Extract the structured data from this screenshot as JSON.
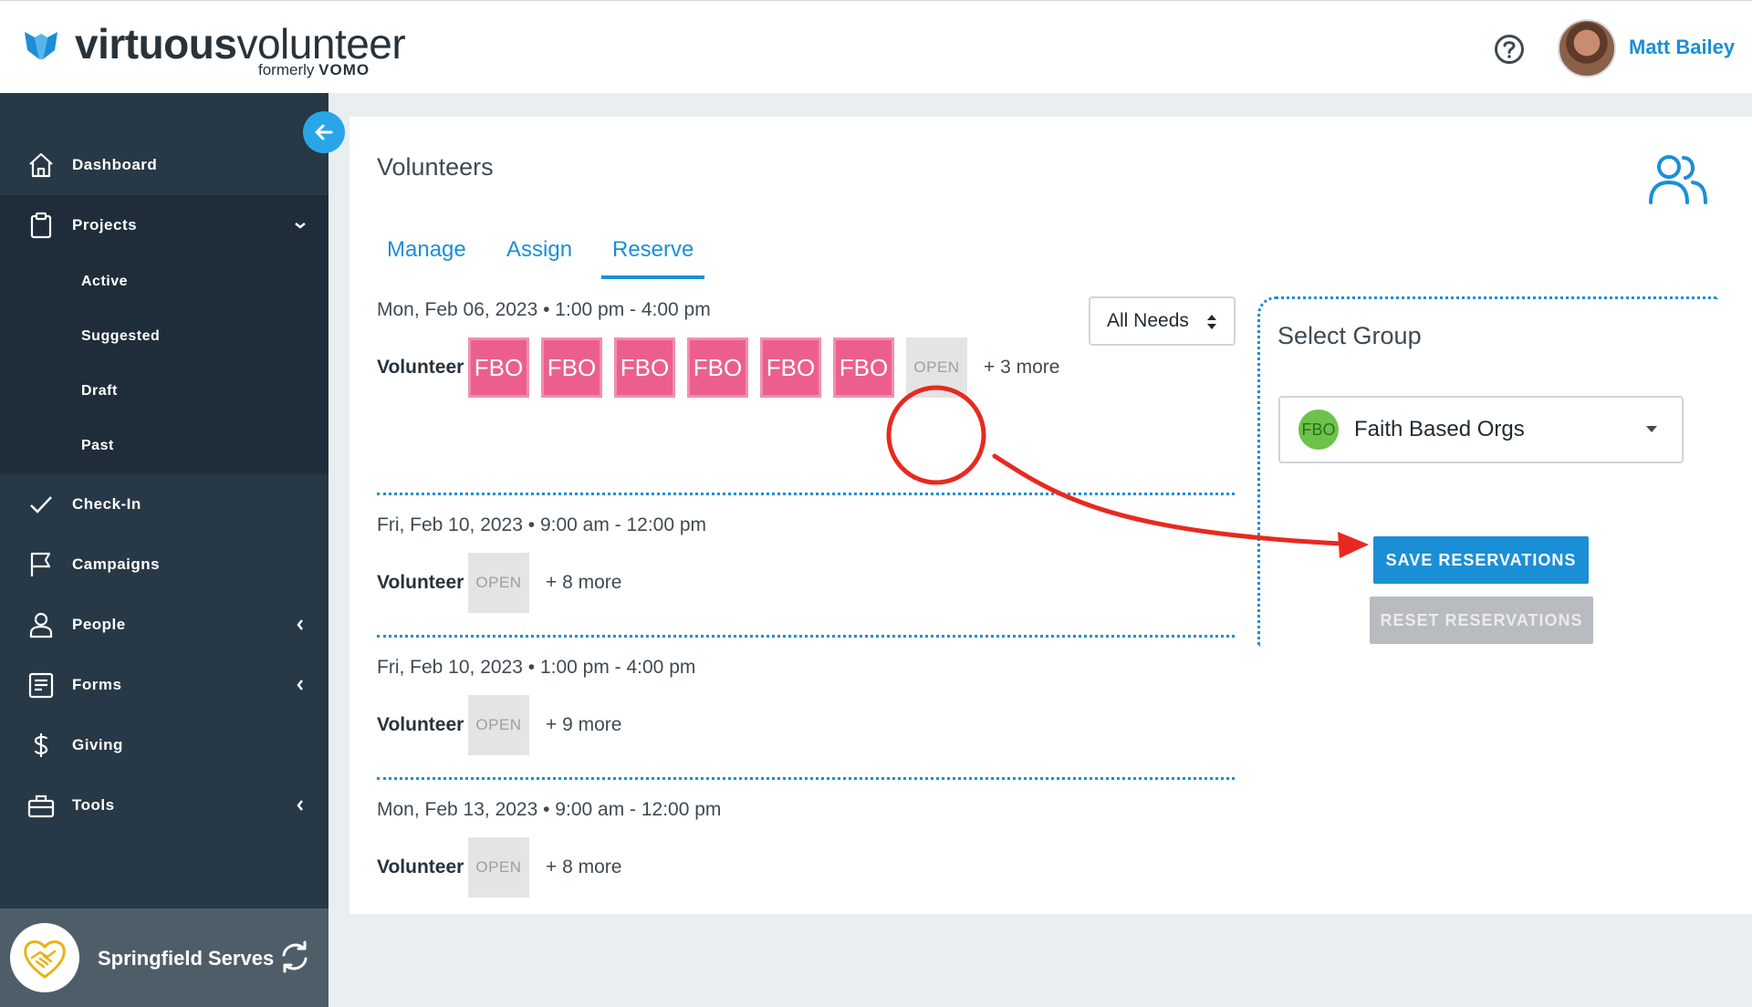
{
  "brand": {
    "name_bold": "virtuous",
    "name_light": "volunteer",
    "formerly_label": "formerly",
    "formerly_brand": "VOMO",
    "color": "#1b8fd6"
  },
  "header": {
    "help_icon": "question-circle-icon",
    "user_name": "Matt Bailey"
  },
  "sidebar": {
    "items": [
      {
        "label": "Dashboard",
        "icon": "home-icon"
      },
      {
        "label": "Projects",
        "icon": "clipboard-icon",
        "caret": "chevron-down"
      },
      {
        "label": "Check-In",
        "icon": "check-icon"
      },
      {
        "label": "Campaigns",
        "icon": "flag-icon"
      },
      {
        "label": "People",
        "icon": "person-icon",
        "caret": "chevron-left"
      },
      {
        "label": "Forms",
        "icon": "form-icon",
        "caret": "chevron-left"
      },
      {
        "label": "Giving",
        "icon": "dollar-icon"
      },
      {
        "label": "Tools",
        "icon": "toolbox-icon",
        "caret": "chevron-left"
      }
    ],
    "project_subitems": [
      "Active",
      "Suggested",
      "Draft",
      "Past"
    ],
    "org_name": "Springfield Serves"
  },
  "main": {
    "title": "Volunteers",
    "tabs": [
      "Manage",
      "Assign",
      "Reserve"
    ],
    "active_tab": "Reserve",
    "needs_filter": "All Needs",
    "slots": [
      {
        "date": "Mon, Feb 06, 2023 • 1:00 pm - 4:00 pm",
        "role": "Volunteer",
        "chips": [
          "FBO",
          "FBO",
          "FBO",
          "FBO",
          "FBO",
          "FBO"
        ],
        "open_label": "OPEN",
        "more": "+ 3 more"
      },
      {
        "date": "Fri, Feb 10, 2023 • 9:00 am - 12:00 pm",
        "role": "Volunteer",
        "chips": [],
        "open_label": "OPEN",
        "more": "+ 8 more"
      },
      {
        "date": "Fri, Feb 10, 2023 • 1:00 pm - 4:00 pm",
        "role": "Volunteer",
        "chips": [],
        "open_label": "OPEN",
        "more": "+ 9 more"
      },
      {
        "date": "Mon, Feb 13, 2023 • 9:00 am - 12:00 pm",
        "role": "Volunteer",
        "chips": [],
        "open_label": "OPEN",
        "more": "+ 8 more"
      }
    ]
  },
  "group_panel": {
    "title": "Select Group",
    "selected_badge": "FBO",
    "selected_name": "Faith Based Orgs",
    "save_label": "SAVE RESERVATIONS",
    "reset_label": "RESET RESERVATIONS"
  },
  "colors": {
    "sidebar_bg": "#273846",
    "fbo_chip": "#ec5f8c",
    "annotation_red": "#e8291f"
  }
}
